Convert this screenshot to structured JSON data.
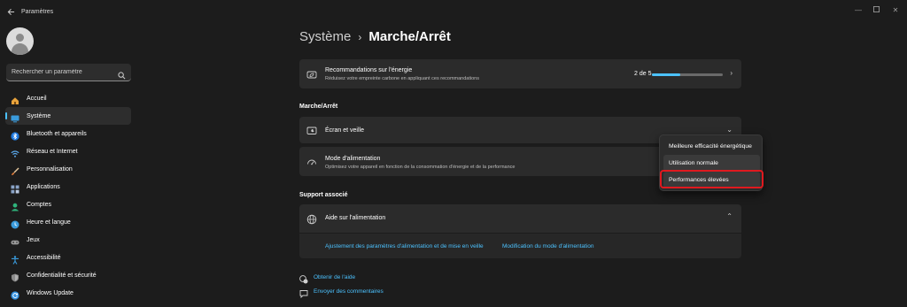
{
  "window": {
    "title": "Paramètres",
    "controls": [
      "minimize",
      "maximize",
      "close"
    ]
  },
  "search": {
    "placeholder": "Rechercher un paramètre"
  },
  "sidebar": {
    "items": [
      {
        "label": "Accueil",
        "icon": "home-icon",
        "color": "#e8a33c"
      },
      {
        "label": "Système",
        "icon": "monitor-icon",
        "color": "#3a9bdc",
        "active": true
      },
      {
        "label": "Bluetooth et appareils",
        "icon": "bluetooth-icon",
        "color": "#1f7ae0"
      },
      {
        "label": "Réseau et Internet",
        "icon": "wifi-icon",
        "color": "#5aa7e8"
      },
      {
        "label": "Personnalisation",
        "icon": "brush-icon",
        "color": "#e07b39"
      },
      {
        "label": "Applications",
        "icon": "apps-icon",
        "color": "#8aa4c8"
      },
      {
        "label": "Comptes",
        "icon": "account-icon",
        "color": "#2fb37b"
      },
      {
        "label": "Heure et langue",
        "icon": "globe-clock-icon",
        "color": "#3a9bdc"
      },
      {
        "label": "Jeux",
        "icon": "gamepad-icon",
        "color": "#9a9a9a"
      },
      {
        "label": "Accessibilité",
        "icon": "accessibility-icon",
        "color": "#3a9bdc"
      },
      {
        "label": "Confidentialité et sécurité",
        "icon": "shield-icon",
        "color": "#8a8a8a"
      },
      {
        "label": "Windows Update",
        "icon": "update-icon",
        "color": "#2f8fe0"
      }
    ]
  },
  "breadcrumb": {
    "parent": "Système",
    "separator": "›",
    "current": "Marche/Arrêt"
  },
  "energy_card": {
    "title": "Recommandations sur l'énergie",
    "subtitle": "Réduisez votre empreinte carbone en appliquant ces recommandations",
    "progress_text": "2 de 5",
    "progress_fraction": 0.4
  },
  "section_power": {
    "title": "Marche/Arrêt"
  },
  "screen_card": {
    "title": "Écran et veille"
  },
  "power_mode_card": {
    "title": "Mode d'alimentation",
    "subtitle": "Optimisez votre appareil en fonction de la consommation d'énergie et de la performance"
  },
  "power_mode_dropdown": {
    "options": [
      "Meilleure efficacité énergétique",
      "Utilisation normale",
      "Performances élevées"
    ],
    "selected": "Utilisation normale",
    "highlighted": "Performances élevées"
  },
  "section_support": {
    "title": "Support associé"
  },
  "support_card": {
    "title": "Aide sur l'alimentation",
    "links": [
      "Ajustement des paramètres d'alimentation et de mise en veille",
      "Modification du mode d'alimentation"
    ]
  },
  "footer": {
    "help": "Obtenir de l'aide",
    "feedback": "Envoyer des commentaires"
  },
  "colors": {
    "accent": "#4cc2ff",
    "background": "#1c1c1c",
    "card": "#2b2b2b",
    "highlight_border": "#e0191f"
  }
}
